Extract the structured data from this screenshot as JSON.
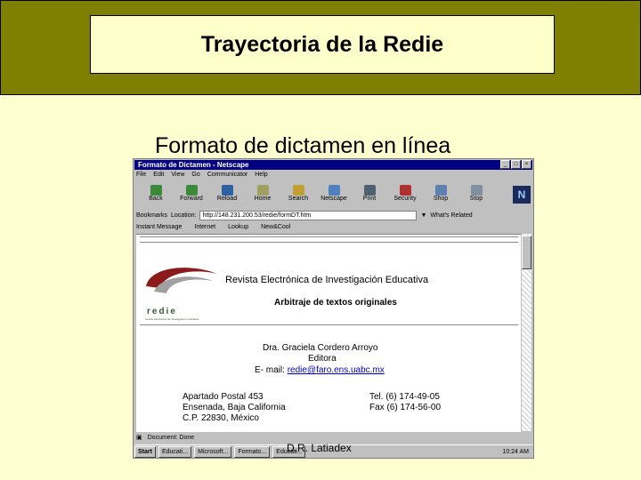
{
  "slide": {
    "title": "Trayectoria de la Redie",
    "subtitle": "Formato de dictamen en línea",
    "footer": "D.R. Latiadex"
  },
  "browser": {
    "window_title": "Formato de Dictamen - Netscape",
    "menu": [
      "File",
      "Edit",
      "View",
      "Go",
      "Communicator",
      "Help"
    ],
    "toolbar": [
      "Back",
      "Forward",
      "Reload",
      "Home",
      "Search",
      "Netscape",
      "Print",
      "Security",
      "Shop",
      "Stop"
    ],
    "bookmarks_label": "Bookmarks",
    "location_label": "Location:",
    "location_value": "http://148.231.200.53/redie/formDT.htm",
    "related_label": "What's Related",
    "links": [
      "Instant Message",
      "Internet",
      "Lookup",
      "New&Cool"
    ],
    "status_text": "Document: Done",
    "taskbar": [
      "Start",
      "Educati...",
      "Microsoft...",
      "Formato...",
      "Educati..."
    ],
    "clock": "10:24 AM"
  },
  "page": {
    "logo_text": "redie",
    "logo_sub": "revista electrónica de investigación educativa",
    "journal": "Revista Electrónica de Investigación Educativa",
    "heading": "Arbitraje de textos originales",
    "editor_name": "Dra. Graciela Cordero Arroyo",
    "editor_role": "Editora",
    "email_label": "E- mail:",
    "email": "redie@faro.ens.uabc.mx",
    "addr1": "Apartado Postal 453",
    "addr2": "Ensenada, Baja California",
    "addr3": "C.P. 22830, México",
    "tel": "Tel. (6) 174-49-05",
    "fax": "Fax (6) 174-56-00"
  },
  "colors": {
    "band": "#7f7f00",
    "background": "#fefed0",
    "title_box": "#ffffcc",
    "window_title": "#000080",
    "logo_red": "#8b1a1a"
  }
}
